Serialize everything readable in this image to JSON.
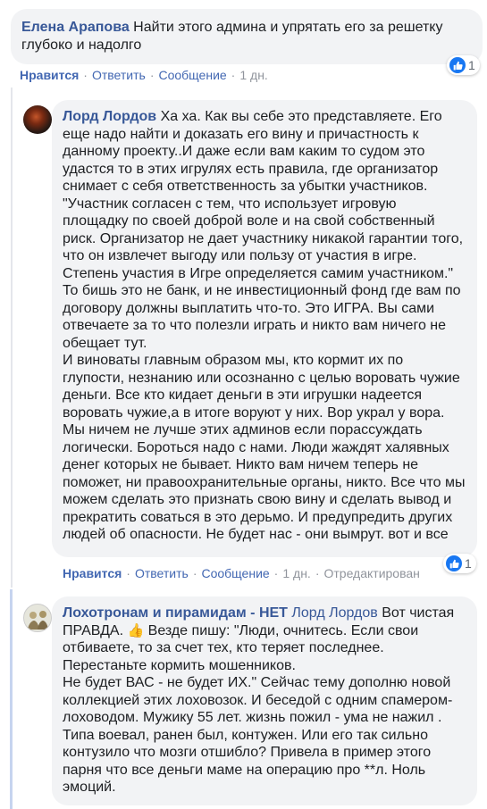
{
  "comments": [
    {
      "author": "Елена Арапова",
      "text_lines": [
        "Найти этого админа и упрятать его за решетку",
        "глубоко и надолго"
      ],
      "actions": {
        "like": "Нравится",
        "reply": "Ответить",
        "message": "Сообщение",
        "time": "1 дн."
      },
      "reactions": {
        "icon": "like-icon",
        "count": "1"
      }
    },
    {
      "author": "Лорд Лордов",
      "text_lines": [
        "Ха ха. Как вы себе это представляете. Его",
        "еще надо найти и доказать его вину и причастность к",
        "данному проекту..И даже если вам каким то судом это",
        "удастся то в этих игрулях есть правила, где организатор",
        "снимает с себя ответственность за убытки участников.",
        "\"Участник согласен с тем, что использует игровую",
        "площадку по своей доброй воле и на свой собственный",
        "риск. Организатор не дает участнику никакой гарантии того,",
        "что он извлечет выгоду или пользу от участия в игре.",
        "Степень участия в Игре определяется самим участником.\"",
        "То бишь это не банк, и не инвестиционный фонд где вам по",
        "договору должны выплатить что-то. Это ИГРА. Вы сами",
        "отвечаете за то что полезли играть и никто вам ничего не",
        "обещает тут.",
        "И виноваты главным образом мы, кто кормит их по",
        "глупости, незнанию или осознанно с целью воровать чужие",
        "деньги. Все кто кидает деньги в эти игрушки надеется",
        "воровать чужие,а в итоге воруют у них. Вор украл у вора.",
        "Мы ничем не лучше этих админов если порассуждать",
        "логически. Бороться надо с нами. Люди жаждят халявных",
        "денег которых не бывает. Никто вам ничем теперь не",
        "поможет, ни правоохранительные органы, никто. Все что мы",
        "можем сделать это признать свою вину и сделать вывод и",
        "прекратить соваться в это дерьмо. И предупредить других",
        "людей об опасности. Не будет нас - они вымрут. вот и все"
      ],
      "actions": {
        "like": "Нравится",
        "reply": "Ответить",
        "message": "Сообщение",
        "time": "1 дн.",
        "edited": "Отредактирован"
      },
      "reactions": {
        "icon": "like-icon",
        "count": "1"
      }
    },
    {
      "author": "Лохотронам и пирамидам - НЕТ",
      "mention": "Лорд Лордов",
      "first_line_rest": "Вот чистая",
      "second_line_start": "ПРАВДА.",
      "emoji": "👍",
      "second_line_rest": "Везде пишу: \"Люди, очнитесь. Если свои",
      "text_lines": [
        "отбиваете, то за счет тех, кто теряет последнее.",
        "Перестаньте кормить мошенников.",
        "Не будет ВАС - не будет ИХ.\" Сейчас тему дополню новой",
        "коллекцией этих лоховозок. И беседой с одним спамером-",
        "лоховодом. Мужику 55 лет. жизнь пожил - ума не нажил .",
        "Типа воевал, ранен был, контужен. Или его так сильно",
        "контузило что мозги отшибло? Привела в пример этого",
        "парня что все деньги маме на операцию про **л. Ноль",
        "эмоций."
      ]
    }
  ],
  "colors": {
    "link": "#385898",
    "action": "#4267b2",
    "meta": "#90949c",
    "bubble": "#f2f3f5",
    "like_blue": "#1877f2"
  }
}
